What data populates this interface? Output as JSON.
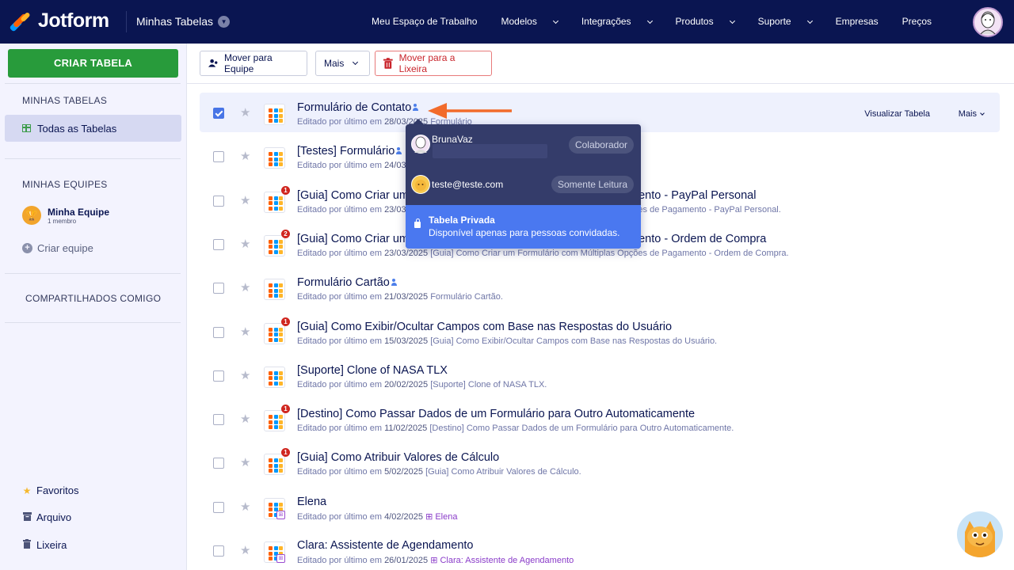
{
  "header": {
    "brand": "Jotform",
    "workspace_title": "Minhas Tabelas",
    "nav": [
      {
        "label": "Meu Espaço de Trabalho",
        "has_menu": false
      },
      {
        "label": "Modelos",
        "has_menu": true
      },
      {
        "label": "Integrações",
        "has_menu": true
      },
      {
        "label": "Produtos",
        "has_menu": true
      },
      {
        "label": "Suporte",
        "has_menu": true
      },
      {
        "label": "Empresas",
        "has_menu": false
      },
      {
        "label": "Preços",
        "has_menu": false
      }
    ]
  },
  "sidebar": {
    "create_label": "CRIAR TABELA",
    "my_tables_heading": "MINHAS TABELAS",
    "all_tables_label": "Todas as Tabelas",
    "my_teams_heading": "MINHAS EQUIPES",
    "team_name": "Minha Equipe",
    "team_members": "1 membro",
    "create_team_label": "Criar equipe",
    "shared_heading": "COMPARTILHADOS COMIGO",
    "favorites_label": "Favoritos",
    "archive_label": "Arquivo",
    "trash_label": "Lixeira"
  },
  "toolbar": {
    "move_team_label": "Mover para Equipe",
    "more_label": "Mais",
    "trash_label": "Mover para a Lixeira"
  },
  "rows": [
    {
      "title": "Formulário de Contato",
      "shared": true,
      "badge": "",
      "table_source": false,
      "edited_prefix": "Editado por último em",
      "date": "28/03/2025",
      "source": "Formulário",
      "selected": true,
      "view_label": "Visualizar Tabela",
      "more_label": "Mais"
    },
    {
      "title": "[Testes] Formulário",
      "shared": true,
      "badge": "",
      "table_source": false,
      "edited_prefix": "Editado por último em",
      "date": "24/03/2025",
      "source": "",
      "selected": false
    },
    {
      "title": "[Guia] Como Criar um Formulário com Múltiplas Opções de Pagamento - PayPal Personal",
      "shared": false,
      "badge": "1",
      "table_source": false,
      "edited_prefix": "Editado por último em",
      "date": "23/03/2025",
      "source": "[Guia] Como Criar um Formulário com Múltiplas Opções de Pagamento - PayPal Personal.",
      "selected": false
    },
    {
      "title": "[Guia] Como Criar um Formulário com Múltiplas Opções de Pagamento - Ordem de Compra",
      "shared": false,
      "badge": "2",
      "table_source": false,
      "edited_prefix": "Editado por último em",
      "date": "23/03/2025",
      "source": "[Guia] Como Criar um Formulário com Múltiplas Opções de Pagamento - Ordem de Compra.",
      "selected": false
    },
    {
      "title": "Formulário Cartão",
      "shared": true,
      "badge": "",
      "table_source": false,
      "edited_prefix": "Editado por último em",
      "date": "21/03/2025",
      "source": "Formulário Cartão.",
      "selected": false
    },
    {
      "title": "[Guia] Como Exibir/Ocultar Campos com Base nas Respostas do Usuário",
      "shared": false,
      "badge": "1",
      "table_source": false,
      "edited_prefix": "Editado por último em",
      "date": "15/03/2025",
      "source": "[Guia] Como Exibir/Ocultar Campos com Base nas Respostas do Usuário.",
      "selected": false
    },
    {
      "title": "[Suporte] Clone of NASA TLX",
      "shared": false,
      "badge": "",
      "table_source": false,
      "edited_prefix": "Editado por último em",
      "date": "20/02/2025",
      "source": "[Suporte] Clone of NASA TLX.",
      "selected": false
    },
    {
      "title": "[Destino] Como Passar Dados de um Formulário para Outro Automaticamente",
      "shared": false,
      "badge": "1",
      "table_source": false,
      "edited_prefix": "Editado por último em",
      "date": "11/02/2025",
      "source": "[Destino] Como Passar Dados de um Formulário para Outro Automaticamente.",
      "selected": false
    },
    {
      "title": "[Guia] Como Atribuir Valores de Cálculo",
      "shared": false,
      "badge": "1",
      "table_source": false,
      "edited_prefix": "Editado por último em",
      "date": "5/02/2025",
      "source": "[Guia] Como Atribuir Valores de Cálculo.",
      "selected": false
    },
    {
      "title": "Elena",
      "shared": false,
      "badge": "",
      "table_source": true,
      "edited_prefix": "Editado por último em",
      "date": "4/02/2025",
      "source": "Elena",
      "selected": false
    },
    {
      "title": "Clara: Assistente de Agendamento",
      "shared": false,
      "badge": "",
      "table_source": true,
      "edited_prefix": "Editado por último em",
      "date": "26/01/2025",
      "source": "Clara: Assistente de Agendamento",
      "selected": false
    }
  ],
  "popover": {
    "user1_name": "BrunaVaz",
    "user1_role": "Colaborador",
    "user2_email": "teste@teste.com",
    "user2_role": "Somente Leitura",
    "private_title": "Tabela Privada",
    "private_desc": "Disponível apenas para pessoas convidadas."
  },
  "colors": {
    "navy": "#0a1551",
    "green": "#289b3b",
    "accent_blue": "#4a78f0",
    "badge_red": "#d0261f",
    "arrow_orange": "#f26b2b"
  }
}
